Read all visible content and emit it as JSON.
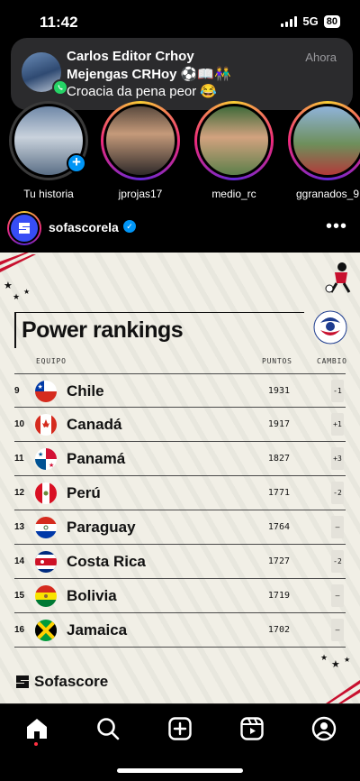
{
  "status_bar": {
    "time": "11:42",
    "network": "5G",
    "battery": "80"
  },
  "notification": {
    "title": "Carlos Editor Crhoy",
    "subtitle": "Mejengas CRHoy ⚽📖👫",
    "message": "Croacia da pena peor 😂",
    "time": "Ahora",
    "app_icon": "whatsapp-icon"
  },
  "stories": [
    {
      "label": "Tu historia",
      "own": true
    },
    {
      "label": "jprojas17"
    },
    {
      "label": "medio_rc"
    },
    {
      "label": "ggranados_9"
    }
  ],
  "post": {
    "username": "sofascorela",
    "verified": true,
    "more": "•••"
  },
  "rankings": {
    "title": "Power rankings",
    "col_team": "EQUIPO",
    "col_points": "PUNTOS",
    "col_change": "CAMBIO",
    "brand": "Sofascore",
    "rows": [
      {
        "rank": "9",
        "team": "Chile",
        "points": "1931",
        "change": "-1",
        "dir": "down"
      },
      {
        "rank": "10",
        "team": "Canadá",
        "points": "1917",
        "change": "+1",
        "dir": "up"
      },
      {
        "rank": "11",
        "team": "Panamá",
        "points": "1827",
        "change": "+3",
        "dir": "up"
      },
      {
        "rank": "12",
        "team": "Perú",
        "points": "1771",
        "change": "-2",
        "dir": "down"
      },
      {
        "rank": "13",
        "team": "Paraguay",
        "points": "1764",
        "change": "–",
        "dir": "none"
      },
      {
        "rank": "14",
        "team": "Costa Rica",
        "points": "1727",
        "change": "-2",
        "dir": "down"
      },
      {
        "rank": "15",
        "team": "Bolivia",
        "points": "1719",
        "change": "–",
        "dir": "none"
      },
      {
        "rank": "16",
        "team": "Jamaica",
        "points": "1702",
        "change": "–",
        "dir": "none"
      }
    ]
  },
  "nav": {
    "items": [
      "home-icon",
      "search-icon",
      "create-icon",
      "reels-icon",
      "profile-icon"
    ]
  }
}
